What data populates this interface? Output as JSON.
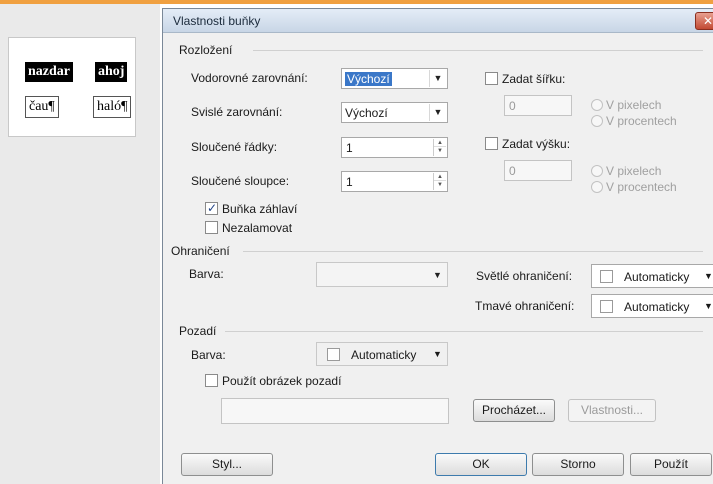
{
  "document": {
    "cells": [
      "nazdar",
      "ahoj",
      "čau¶",
      "haló¶"
    ]
  },
  "dialog": {
    "title": "Vlastnosti buňky",
    "close_glyph": "✕",
    "layout": {
      "title": "Rozložení",
      "h_align_label": "Vodorovné zarovnání:",
      "h_align_value": "Výchozí",
      "v_align_label": "Svislé zarovnání:",
      "v_align_value": "Výchozí",
      "merged_rows_label": "Sloučené řádky:",
      "merged_rows_value": "1",
      "merged_cols_label": "Sloučené sloupce:",
      "merged_cols_value": "1",
      "width_label": "Zadat šířku:",
      "width_value": "0",
      "height_label": "Zadat výšku:",
      "height_value": "0",
      "px_label": "V pixelech",
      "pct_label": "V procentech",
      "header_cell_label": "Buňka záhlaví",
      "header_cell_checked": true,
      "nowrap_label": "Nezalamovat",
      "nowrap_checked": false
    },
    "borders": {
      "title": "Ohraničení",
      "color_label": "Barva:",
      "light_label": "Světlé ohraničení:",
      "light_value": "Automaticky",
      "dark_label": "Tmavé ohraničení:",
      "dark_value": "Automaticky"
    },
    "background": {
      "title": "Pozadí",
      "color_label": "Barva:",
      "color_value": "Automaticky",
      "use_image_label": "Použít obrázek pozadí",
      "use_image_checked": false,
      "browse_label": "Procházet...",
      "properties_label": "Vlastnosti..."
    },
    "buttons": {
      "style": "Styl...",
      "ok": "OK",
      "cancel": "Storno",
      "apply": "Použít"
    }
  },
  "icons": {
    "dropdown_arrow": "▼",
    "spin_up": "▲",
    "spin_down": "▼"
  },
  "colors": {
    "selection": "#3a77c8",
    "accent_bar": "#f0a040",
    "close_button": "#c24a33"
  }
}
